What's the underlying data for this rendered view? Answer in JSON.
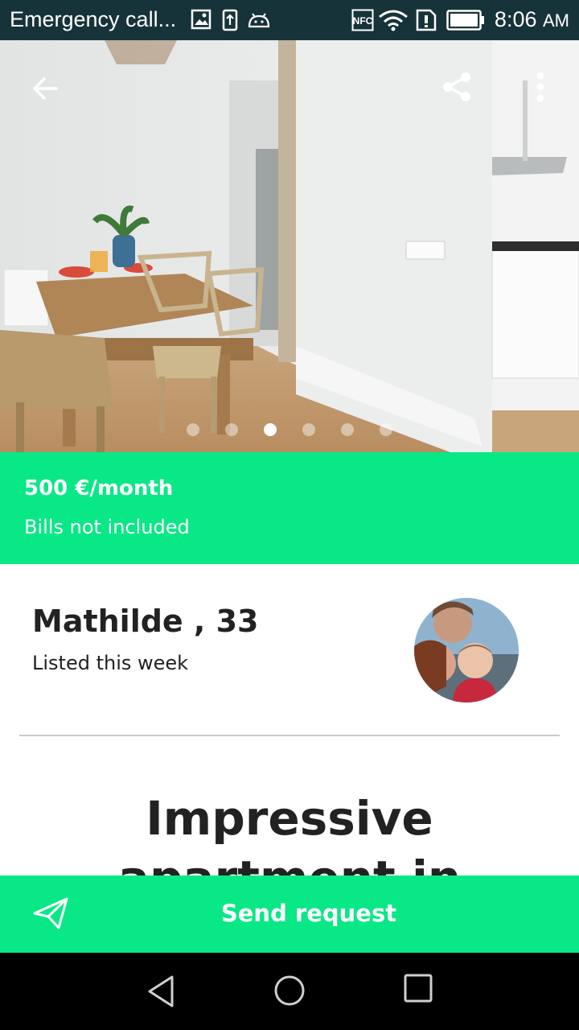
{
  "status_bar": {
    "title": "Emergency call...",
    "time": "8:06",
    "ampm": "AM",
    "icons": [
      "image-icon",
      "upload-icon",
      "android-icon",
      "nfc-icon",
      "wifi-icon",
      "sim-alert-icon",
      "battery-icon"
    ]
  },
  "hero": {
    "icons": [
      "back-arrow-icon",
      "share-icon",
      "more-vert-icon"
    ],
    "carousel": {
      "total": 6,
      "active_index": 2
    }
  },
  "price": {
    "amount": "500 €/month",
    "note": "Bills not included"
  },
  "host": {
    "name": "Mathilde , 33",
    "listed": "Listed this week"
  },
  "listing": {
    "title": "Impressive apartment in the"
  },
  "actions": {
    "send_label": "Send request",
    "send_icon": "send-icon"
  },
  "nav": {
    "icons": [
      "nav-back-icon",
      "nav-home-icon",
      "nav-recents-icon"
    ]
  },
  "colors": {
    "accent": "#09e886",
    "status_bar": "#17333a",
    "text_dark": "#222222"
  }
}
